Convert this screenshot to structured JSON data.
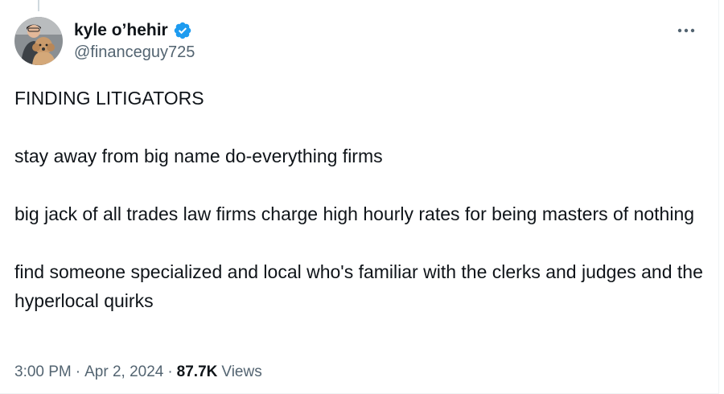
{
  "author": {
    "display_name": "kyle o’hehir",
    "handle": "@financeguy725",
    "verified": true,
    "avatar_icon": "avatar-with-dog"
  },
  "tweet": {
    "paragraphs": [
      "FINDING LITIGATORS",
      "stay away from big name do-everything firms",
      "big jack of all trades law firms charge high hourly rates for being masters of nothing",
      "find someone specialized and local who's familiar with the clerks and judges and the hyperlocal quirks"
    ],
    "time": "3:00 PM",
    "date": "Apr 2, 2024",
    "separator": "·",
    "views_count": "87.7K",
    "views_label": "Views"
  },
  "icons": {
    "verified": "verified-badge-icon",
    "more": "more-options-icon"
  },
  "colors": {
    "text": "#0f1419",
    "secondary": "#536471",
    "verified_blue": "#1d9bf0",
    "border": "#eff3f4"
  }
}
